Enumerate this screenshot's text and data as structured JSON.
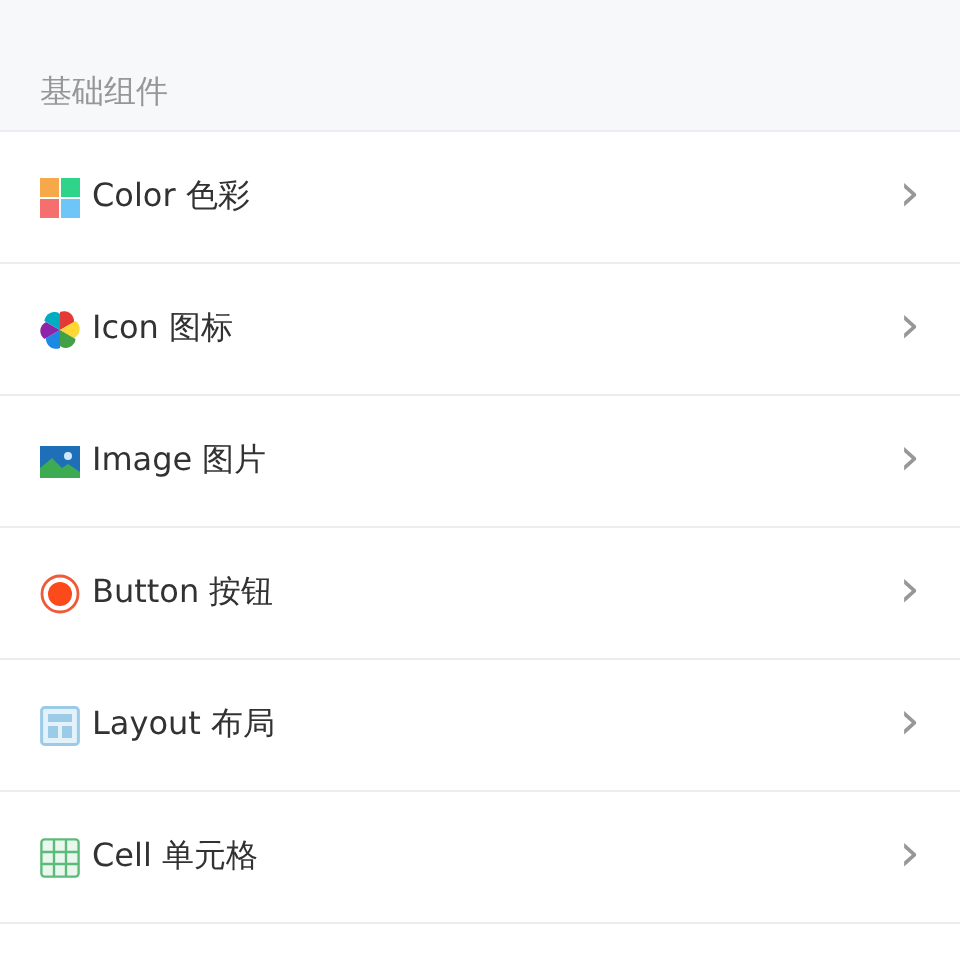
{
  "section_title": "基础组件",
  "items": [
    {
      "kind": "color",
      "label": "Color 色彩",
      "chevron": "›"
    },
    {
      "kind": "icon",
      "label": "Icon 图标",
      "chevron": "›"
    },
    {
      "kind": "image",
      "label": "Image 图片",
      "chevron": "›"
    },
    {
      "kind": "button",
      "label": "Button 按钮",
      "chevron": "›"
    },
    {
      "kind": "layout",
      "label": "Layout 布局",
      "chevron": "›"
    },
    {
      "kind": "cell",
      "label": "Cell 单元格",
      "chevron": "›"
    }
  ]
}
